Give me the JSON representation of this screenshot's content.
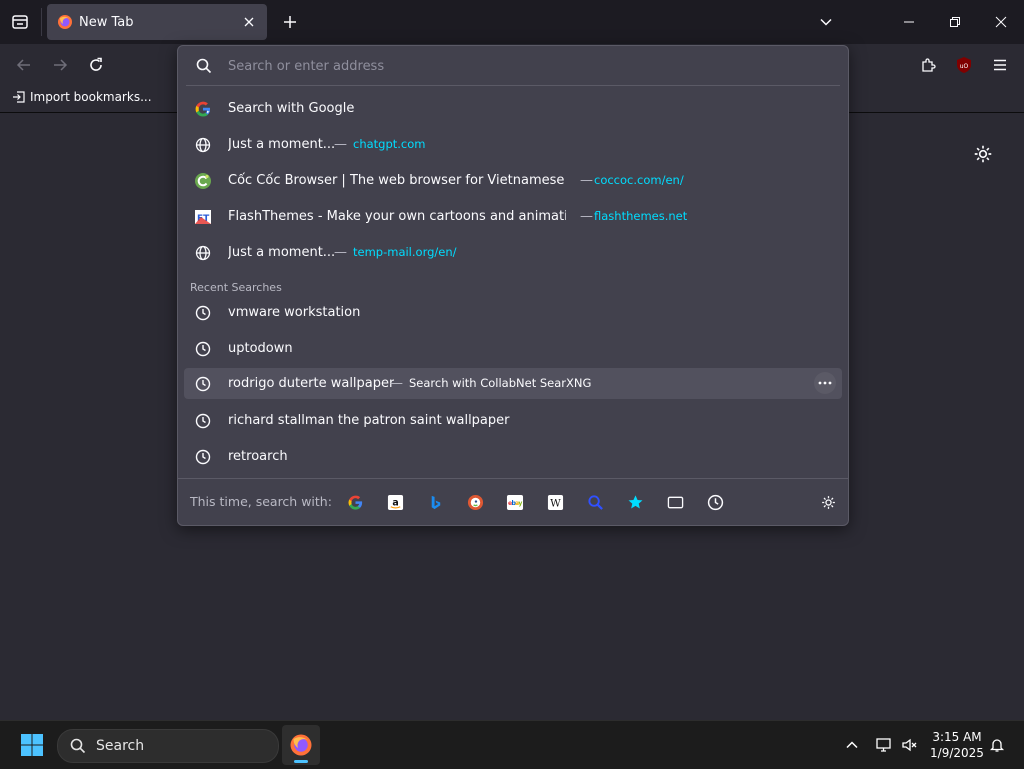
{
  "tab": {
    "title": "New Tab"
  },
  "bookmarks": {
    "import_label": "Import bookmarks..."
  },
  "urlbar": {
    "placeholder": "Search or enter address"
  },
  "suggestions": [
    {
      "icon": "google-icon",
      "title": "Search with Google"
    },
    {
      "icon": "globe-icon",
      "title": "Just a moment...",
      "url": "chatgpt.com"
    },
    {
      "icon": "coccoc-icon",
      "title": "Cốc Cốc Browser | The web browser for Vietnamese pe",
      "url": "coccoc.com/en/"
    },
    {
      "icon": "flashthemes-icon",
      "title": "FlashThemes - Make your own cartoons and animation",
      "url": "flashthemes.net"
    },
    {
      "icon": "globe-icon",
      "title": "Just a moment...",
      "url": "temp-mail.org/en/"
    }
  ],
  "recent": {
    "label": "Recent Searches",
    "items": [
      {
        "title": "vmware workstation"
      },
      {
        "title": "uptodown"
      },
      {
        "title": "rodrigo duterte wallpaper",
        "action": "Search with CollabNet SearXNG",
        "selected": true
      },
      {
        "title": "richard stallman the patron saint wallpaper"
      },
      {
        "title": "retroarch"
      }
    ]
  },
  "separator": "—",
  "search_with": {
    "label": "This time, search with:",
    "engines": [
      "google-icon",
      "amazon-icon",
      "bing-icon",
      "duckduckgo-icon",
      "ebay-icon",
      "wikipedia-icon",
      "searxng-icon",
      "bookmarks-star-icon",
      "tabs-icon",
      "history-icon"
    ]
  },
  "taskbar": {
    "search_label": "Search",
    "time": "3:15 AM",
    "date": "1/9/2025"
  },
  "colors": {
    "url": "#00ddff",
    "popup_bg": "#42414d",
    "toolbar_bg": "#2b2a33",
    "tabbar_bg": "#1c1b22"
  }
}
